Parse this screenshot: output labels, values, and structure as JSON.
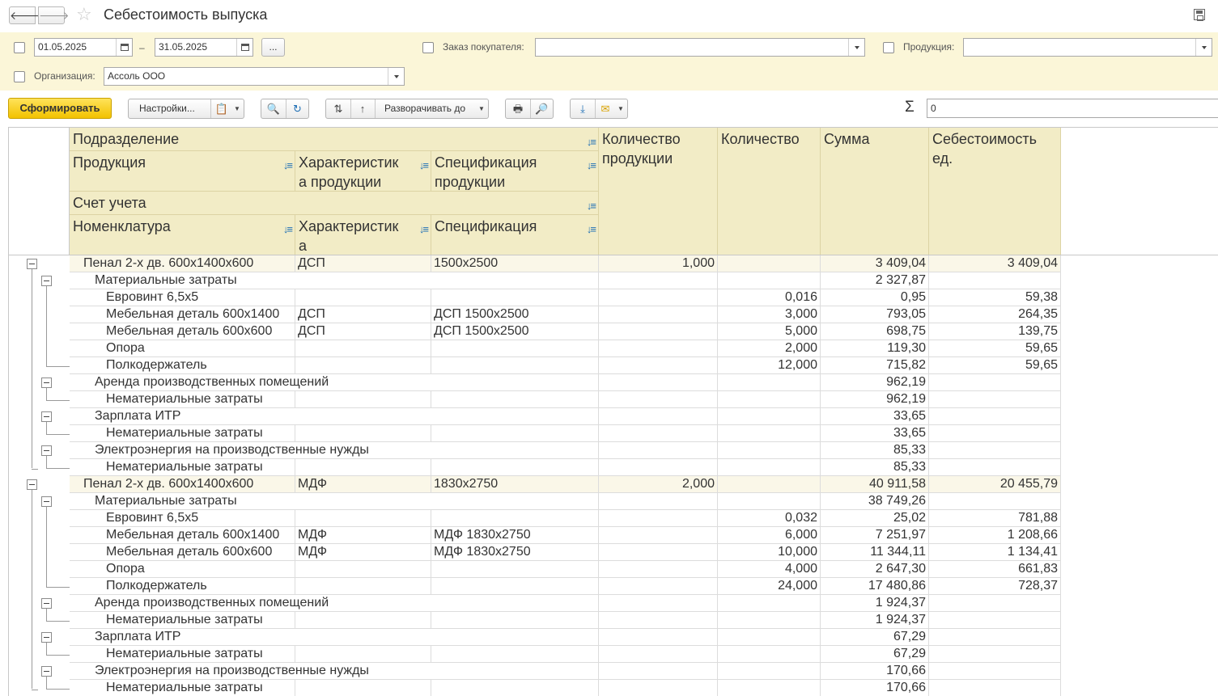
{
  "window": {
    "title": "Себестоимость выпуска"
  },
  "filters": {
    "date_from": "01.05.2025",
    "date_sep": "–",
    "date_to": "31.05.2025",
    "period_btn": "...",
    "order_label": "Заказ покупателя:",
    "order_value": "",
    "product_label": "Продукция:",
    "product_value": "",
    "org_label": "Организация:",
    "org_value": "Ассоль ООО"
  },
  "toolbar": {
    "form_btn": "Сформировать",
    "settings_btn": "Настройки...",
    "expand_btn": "Разворачивать до",
    "sum_value": "0"
  },
  "table": {
    "headers": {
      "division": "Подразделение",
      "product": "Продукция",
      "product_char": "Характеристика продукции",
      "product_spec": "Спецификация продукции",
      "account": "Счет учета",
      "nomenclature": "Номенклатура",
      "char": "Характеристика",
      "spec": "Спецификация",
      "qty_product": "Количество продукции",
      "qty": "Количество",
      "sum": "Сумма",
      "unit_cost": "Себестоимость ед."
    },
    "rows": [
      {
        "lvl": 0,
        "name": "Пенал 2-х дв. 600х1400х600",
        "char": "ДСП",
        "spec": "1500х2500",
        "qprod": "1,000",
        "qty": "",
        "sum": "3 409,04",
        "cost": "3 409,04"
      },
      {
        "lvl": 1,
        "name": "Материальные затраты",
        "char": "",
        "spec": "",
        "qprod": "",
        "qty": "",
        "sum": "2 327,87",
        "cost": ""
      },
      {
        "lvl": 2,
        "name": "Евровинт 6,5х5",
        "char": "",
        "spec": "",
        "qprod": "",
        "qty": "0,016",
        "sum": "0,95",
        "cost": "59,38"
      },
      {
        "lvl": 2,
        "name": "Мебельная деталь 600х1400",
        "char": "ДСП",
        "spec": "ДСП 1500х2500",
        "qprod": "",
        "qty": "3,000",
        "sum": "793,05",
        "cost": "264,35"
      },
      {
        "lvl": 2,
        "name": "Мебельная деталь 600х600",
        "char": "ДСП",
        "spec": "ДСП 1500х2500",
        "qprod": "",
        "qty": "5,000",
        "sum": "698,75",
        "cost": "139,75"
      },
      {
        "lvl": 2,
        "name": "Опора",
        "char": "",
        "spec": "",
        "qprod": "",
        "qty": "2,000",
        "sum": "119,30",
        "cost": "59,65"
      },
      {
        "lvl": 2,
        "name": "Полкодержатель",
        "char": "",
        "spec": "",
        "qprod": "",
        "qty": "12,000",
        "sum": "715,82",
        "cost": "59,65"
      },
      {
        "lvl": 1,
        "name": "Аренда производственных помещений",
        "char": "",
        "spec": "",
        "qprod": "",
        "qty": "",
        "sum": "962,19",
        "cost": ""
      },
      {
        "lvl": 2,
        "name": "Нематериальные затраты",
        "char": "",
        "spec": "",
        "qprod": "",
        "qty": "",
        "sum": "962,19",
        "cost": ""
      },
      {
        "lvl": 1,
        "name": "Зарплата ИТР",
        "char": "",
        "spec": "",
        "qprod": "",
        "qty": "",
        "sum": "33,65",
        "cost": ""
      },
      {
        "lvl": 2,
        "name": "Нематериальные затраты",
        "char": "",
        "spec": "",
        "qprod": "",
        "qty": "",
        "sum": "33,65",
        "cost": ""
      },
      {
        "lvl": 1,
        "name": "Электроэнергия на производственные нужды",
        "char": "",
        "spec": "",
        "qprod": "",
        "qty": "",
        "sum": "85,33",
        "cost": ""
      },
      {
        "lvl": 2,
        "name": "Нематериальные затраты",
        "char": "",
        "spec": "",
        "qprod": "",
        "qty": "",
        "sum": "85,33",
        "cost": ""
      },
      {
        "lvl": 0,
        "name": "Пенал 2-х дв. 600х1400х600",
        "char": "МДФ",
        "spec": "1830х2750",
        "qprod": "2,000",
        "qty": "",
        "sum": "40 911,58",
        "cost": "20 455,79"
      },
      {
        "lvl": 1,
        "name": "Материальные затраты",
        "char": "",
        "spec": "",
        "qprod": "",
        "qty": "",
        "sum": "38 749,26",
        "cost": ""
      },
      {
        "lvl": 2,
        "name": "Евровинт 6,5х5",
        "char": "",
        "spec": "",
        "qprod": "",
        "qty": "0,032",
        "sum": "25,02",
        "cost": "781,88"
      },
      {
        "lvl": 2,
        "name": "Мебельная деталь 600х1400",
        "char": "МДФ",
        "spec": "МДФ 1830х2750",
        "qprod": "",
        "qty": "6,000",
        "sum": "7 251,97",
        "cost": "1 208,66"
      },
      {
        "lvl": 2,
        "name": "Мебельная деталь 600х600",
        "char": "МДФ",
        "spec": "МДФ 1830х2750",
        "qprod": "",
        "qty": "10,000",
        "sum": "11 344,11",
        "cost": "1 134,41"
      },
      {
        "lvl": 2,
        "name": "Опора",
        "char": "",
        "spec": "",
        "qprod": "",
        "qty": "4,000",
        "sum": "2 647,30",
        "cost": "661,83"
      },
      {
        "lvl": 2,
        "name": "Полкодержатель",
        "char": "",
        "spec": "",
        "qprod": "",
        "qty": "24,000",
        "sum": "17 480,86",
        "cost": "728,37"
      },
      {
        "lvl": 1,
        "name": "Аренда производственных помещений",
        "char": "",
        "spec": "",
        "qprod": "",
        "qty": "",
        "sum": "1 924,37",
        "cost": ""
      },
      {
        "lvl": 2,
        "name": "Нематериальные затраты",
        "char": "",
        "spec": "",
        "qprod": "",
        "qty": "",
        "sum": "1 924,37",
        "cost": ""
      },
      {
        "lvl": 1,
        "name": "Зарплата ИТР",
        "char": "",
        "spec": "",
        "qprod": "",
        "qty": "",
        "sum": "67,29",
        "cost": ""
      },
      {
        "lvl": 2,
        "name": "Нематериальные затраты",
        "char": "",
        "spec": "",
        "qprod": "",
        "qty": "",
        "sum": "67,29",
        "cost": ""
      },
      {
        "lvl": 1,
        "name": "Электроэнергия на производственные нужды",
        "char": "",
        "spec": "",
        "qprod": "",
        "qty": "",
        "sum": "170,66",
        "cost": ""
      },
      {
        "lvl": 2,
        "name": "Нематериальные затраты",
        "char": "",
        "spec": "",
        "qprod": "",
        "qty": "",
        "sum": "170,66",
        "cost": ""
      }
    ]
  }
}
